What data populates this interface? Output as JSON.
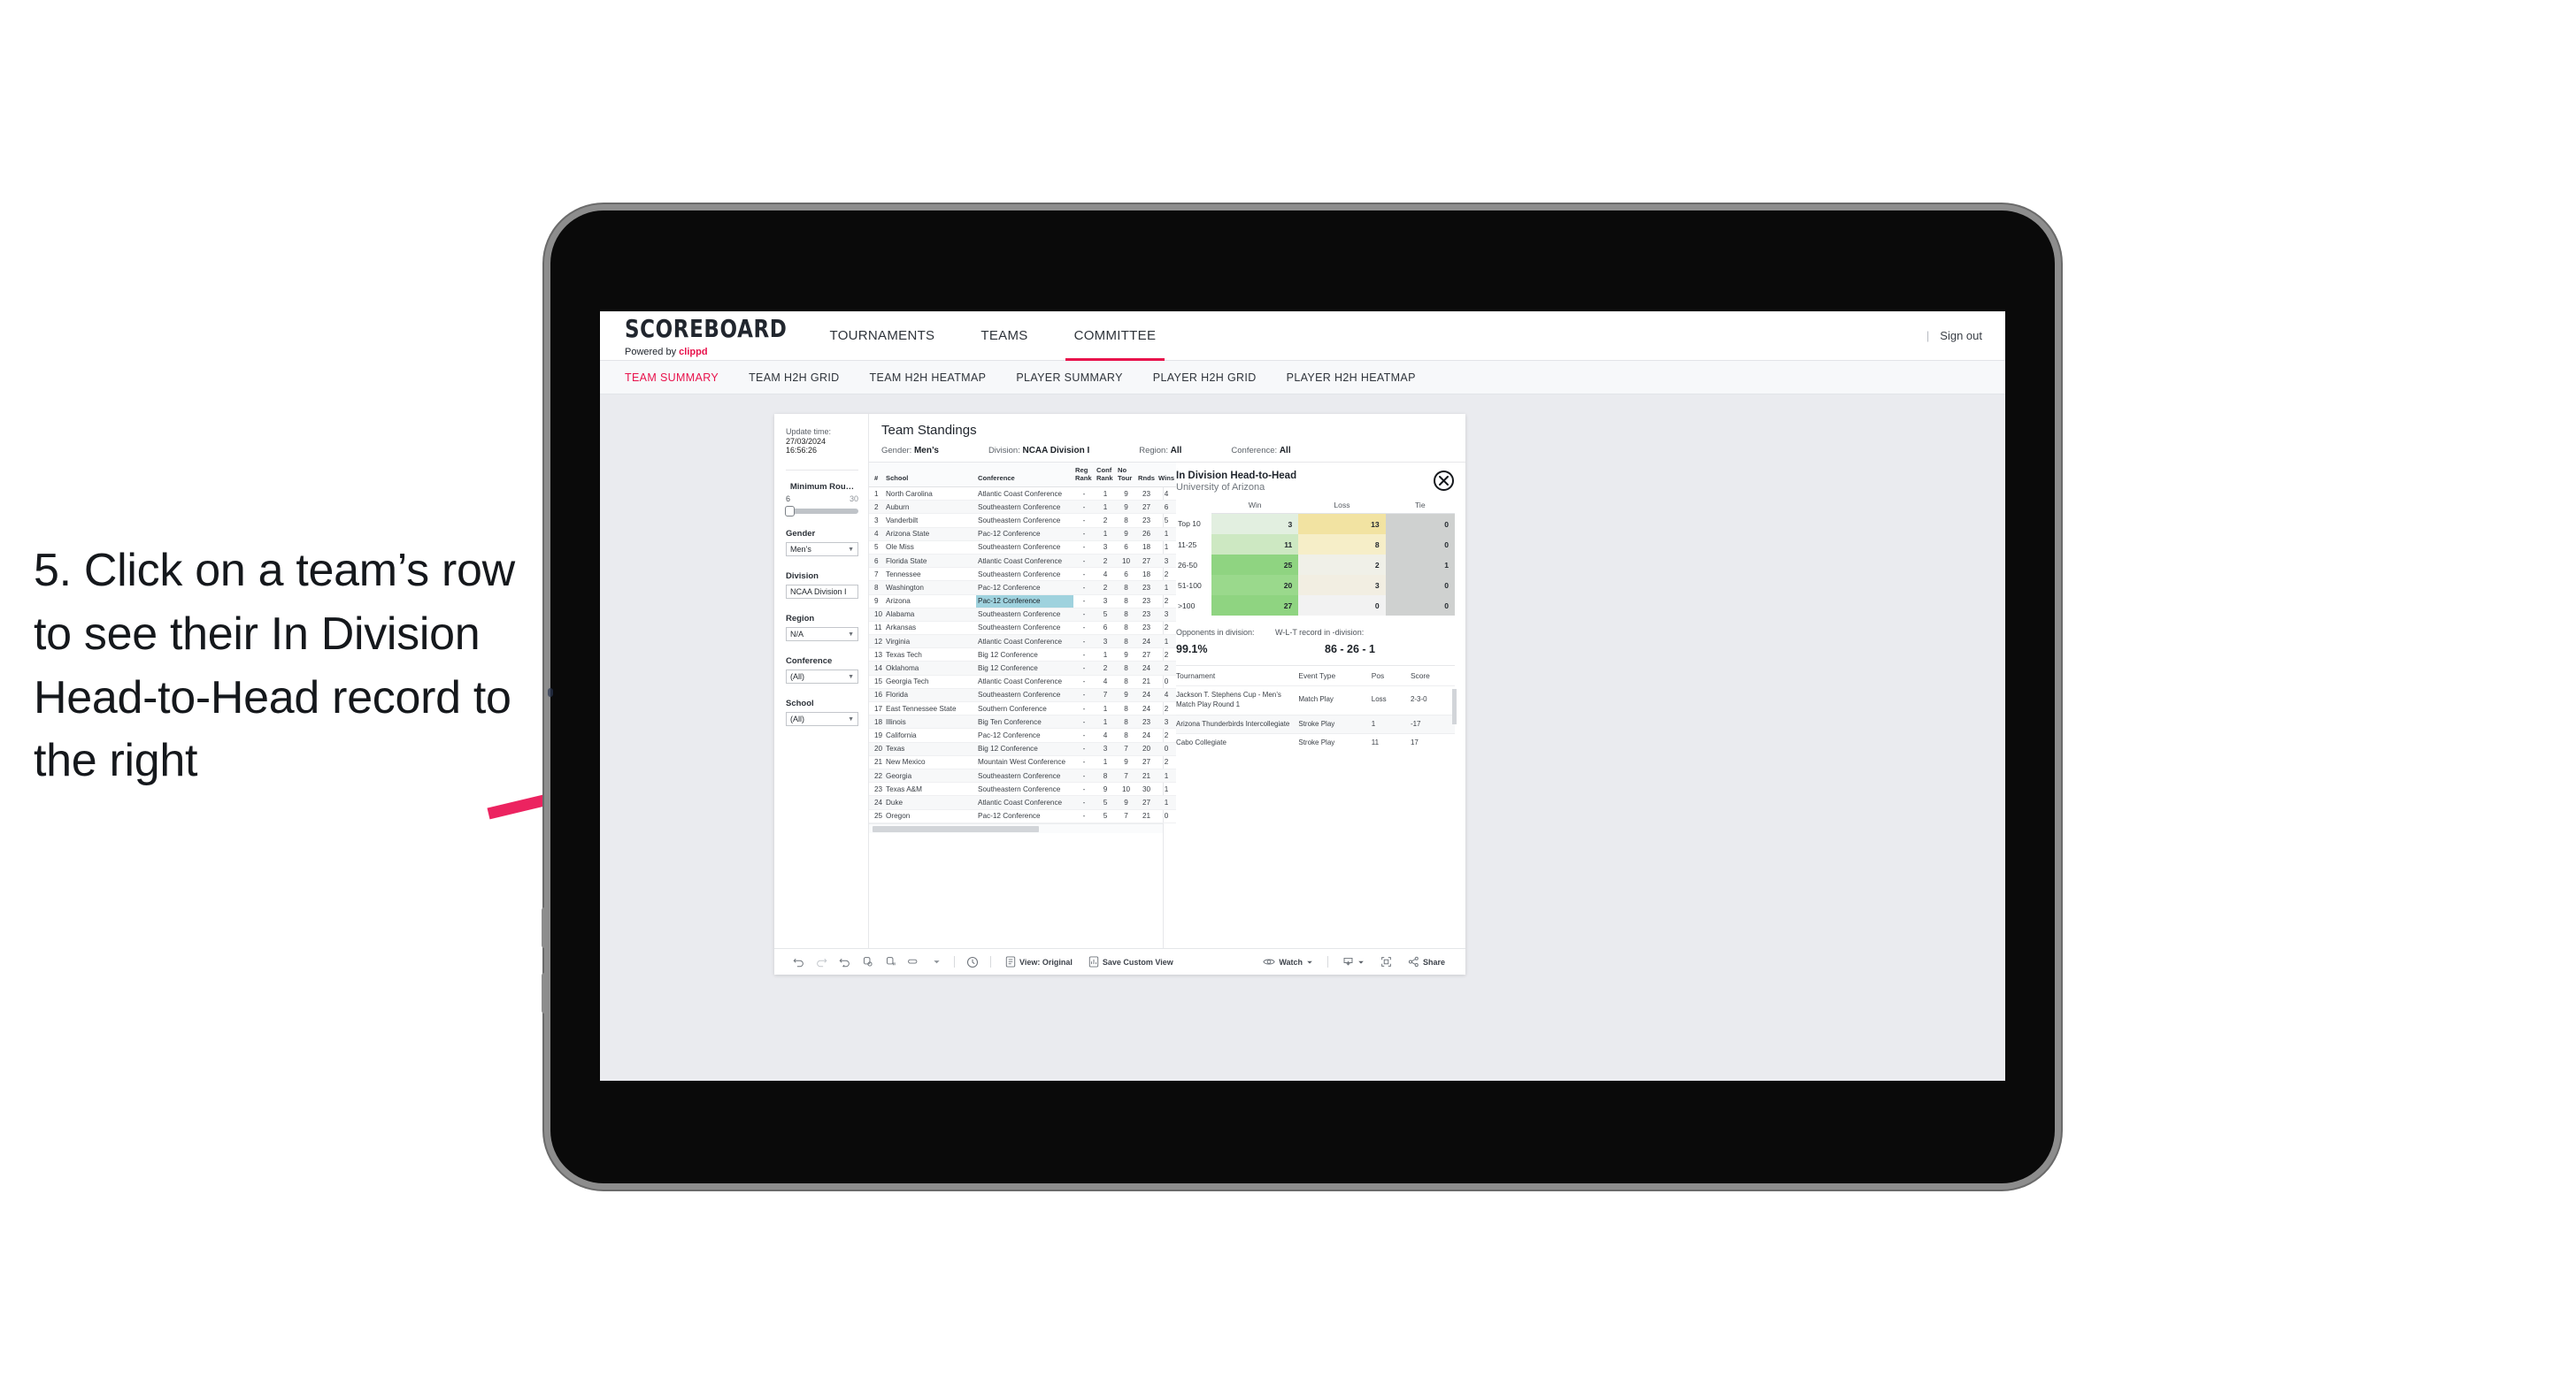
{
  "annotation": {
    "text": "5. Click on a team’s row to see their In Division Head-to-Head record to the right",
    "arrow_color": "#ec2360"
  },
  "app": {
    "logo": {
      "main": "SCOREBOARD",
      "powered_prefix": "Powered by ",
      "brand": "clippd"
    },
    "top_nav": [
      {
        "label": "TOURNAMENTS",
        "active": false
      },
      {
        "label": "TEAMS",
        "active": false
      },
      {
        "label": "COMMITTEE",
        "active": true
      }
    ],
    "sign_out": "Sign out",
    "divider": "|",
    "sub_nav": [
      {
        "label": "TEAM SUMMARY",
        "active": true
      },
      {
        "label": "TEAM H2H GRID",
        "active": false
      },
      {
        "label": "TEAM H2H HEATMAP",
        "active": false
      },
      {
        "label": "PLAYER SUMMARY",
        "active": false
      },
      {
        "label": "PLAYER H2H GRID",
        "active": false
      },
      {
        "label": "PLAYER H2H HEATMAP",
        "active": false
      }
    ],
    "accent": "#e8114b"
  },
  "filters": {
    "update_label": "Update time:",
    "update_time": "27/03/2024 16:56:26",
    "slider": {
      "title": "Minimum Rou…",
      "min": "6",
      "max": "30"
    },
    "groups": [
      {
        "label": "Gender",
        "value": "Men’s",
        "caret": true
      },
      {
        "label": "Division",
        "value": "NCAA Division I",
        "caret": false
      },
      {
        "label": "Region",
        "value": "N/A",
        "caret": true
      },
      {
        "label": "Conference",
        "value": "(All)",
        "caret": true
      },
      {
        "label": "School",
        "value": "(All)",
        "caret": true
      }
    ]
  },
  "standings": {
    "title": "Team Standings",
    "meta": [
      {
        "label": "Gender:",
        "value": "Men’s"
      },
      {
        "label": "Division:",
        "value": "NCAA Division I"
      },
      {
        "label": "Region:",
        "value": "All"
      },
      {
        "label": "Conference:",
        "value": "All"
      }
    ],
    "columns": [
      "#",
      "School",
      "Conference",
      "Reg Rank",
      "Conf Rank",
      "No Tour",
      "Rnds",
      "Wins"
    ],
    "rows": [
      {
        "n": "1",
        "school": "North Carolina",
        "conf": "Atlantic Coast Conference",
        "reg": "-",
        "cr": "1",
        "nt": "9",
        "rnds": "23",
        "wins": "4",
        "selected": false
      },
      {
        "n": "2",
        "school": "Auburn",
        "conf": "Southeastern Conference",
        "reg": "-",
        "cr": "1",
        "nt": "9",
        "rnds": "27",
        "wins": "6",
        "selected": false
      },
      {
        "n": "3",
        "school": "Vanderbilt",
        "conf": "Southeastern Conference",
        "reg": "-",
        "cr": "2",
        "nt": "8",
        "rnds": "23",
        "wins": "5",
        "selected": false
      },
      {
        "n": "4",
        "school": "Arizona State",
        "conf": "Pac-12 Conference",
        "reg": "-",
        "cr": "1",
        "nt": "9",
        "rnds": "26",
        "wins": "1",
        "selected": false
      },
      {
        "n": "5",
        "school": "Ole Miss",
        "conf": "Southeastern Conference",
        "reg": "-",
        "cr": "3",
        "nt": "6",
        "rnds": "18",
        "wins": "1",
        "selected": false
      },
      {
        "n": "6",
        "school": "Florida State",
        "conf": "Atlantic Coast Conference",
        "reg": "-",
        "cr": "2",
        "nt": "10",
        "rnds": "27",
        "wins": "3",
        "selected": false
      },
      {
        "n": "7",
        "school": "Tennessee",
        "conf": "Southeastern Conference",
        "reg": "-",
        "cr": "4",
        "nt": "6",
        "rnds": "18",
        "wins": "2",
        "selected": false
      },
      {
        "n": "8",
        "school": "Washington",
        "conf": "Pac-12 Conference",
        "reg": "-",
        "cr": "2",
        "nt": "8",
        "rnds": "23",
        "wins": "1",
        "selected": false
      },
      {
        "n": "9",
        "school": "Arizona",
        "conf": "Pac-12 Conference",
        "reg": "-",
        "cr": "3",
        "nt": "8",
        "rnds": "23",
        "wins": "2",
        "selected": true
      },
      {
        "n": "10",
        "school": "Alabama",
        "conf": "Southeastern Conference",
        "reg": "-",
        "cr": "5",
        "nt": "8",
        "rnds": "23",
        "wins": "3",
        "selected": false
      },
      {
        "n": "11",
        "school": "Arkansas",
        "conf": "Southeastern Conference",
        "reg": "-",
        "cr": "6",
        "nt": "8",
        "rnds": "23",
        "wins": "2",
        "selected": false
      },
      {
        "n": "12",
        "school": "Virginia",
        "conf": "Atlantic Coast Conference",
        "reg": "-",
        "cr": "3",
        "nt": "8",
        "rnds": "24",
        "wins": "1",
        "selected": false
      },
      {
        "n": "13",
        "school": "Texas Tech",
        "conf": "Big 12 Conference",
        "reg": "-",
        "cr": "1",
        "nt": "9",
        "rnds": "27",
        "wins": "2",
        "selected": false
      },
      {
        "n": "14",
        "school": "Oklahoma",
        "conf": "Big 12 Conference",
        "reg": "-",
        "cr": "2",
        "nt": "8",
        "rnds": "24",
        "wins": "2",
        "selected": false
      },
      {
        "n": "15",
        "school": "Georgia Tech",
        "conf": "Atlantic Coast Conference",
        "reg": "-",
        "cr": "4",
        "nt": "8",
        "rnds": "21",
        "wins": "0",
        "selected": false
      },
      {
        "n": "16",
        "school": "Florida",
        "conf": "Southeastern Conference",
        "reg": "-",
        "cr": "7",
        "nt": "9",
        "rnds": "24",
        "wins": "4",
        "selected": false
      },
      {
        "n": "17",
        "school": "East Tennessee State",
        "conf": "Southern Conference",
        "reg": "-",
        "cr": "1",
        "nt": "8",
        "rnds": "24",
        "wins": "2",
        "selected": false
      },
      {
        "n": "18",
        "school": "Illinois",
        "conf": "Big Ten Conference",
        "reg": "-",
        "cr": "1",
        "nt": "8",
        "rnds": "23",
        "wins": "3",
        "selected": false
      },
      {
        "n": "19",
        "school": "California",
        "conf": "Pac-12 Conference",
        "reg": "-",
        "cr": "4",
        "nt": "8",
        "rnds": "24",
        "wins": "2",
        "selected": false
      },
      {
        "n": "20",
        "school": "Texas",
        "conf": "Big 12 Conference",
        "reg": "-",
        "cr": "3",
        "nt": "7",
        "rnds": "20",
        "wins": "0",
        "selected": false
      },
      {
        "n": "21",
        "school": "New Mexico",
        "conf": "Mountain West Conference",
        "reg": "-",
        "cr": "1",
        "nt": "9",
        "rnds": "27",
        "wins": "2",
        "selected": false
      },
      {
        "n": "22",
        "school": "Georgia",
        "conf": "Southeastern Conference",
        "reg": "-",
        "cr": "8",
        "nt": "7",
        "rnds": "21",
        "wins": "1",
        "selected": false
      },
      {
        "n": "23",
        "school": "Texas A&M",
        "conf": "Southeastern Conference",
        "reg": "-",
        "cr": "9",
        "nt": "10",
        "rnds": "30",
        "wins": "1",
        "selected": false
      },
      {
        "n": "24",
        "school": "Duke",
        "conf": "Atlantic Coast Conference",
        "reg": "-",
        "cr": "5",
        "nt": "9",
        "rnds": "27",
        "wins": "1",
        "selected": false
      },
      {
        "n": "25",
        "school": "Oregon",
        "conf": "Pac-12 Conference",
        "reg": "-",
        "cr": "5",
        "nt": "7",
        "rnds": "21",
        "wins": "0",
        "selected": false
      }
    ]
  },
  "h2h": {
    "title": "In Division Head-to-Head",
    "subtitle": "University of Arizona",
    "close_icon": "close-icon",
    "matrix": {
      "columns": [
        "Win",
        "Loss",
        "Tie"
      ],
      "rows": [
        {
          "label": "Top 10",
          "win": "3",
          "loss": "13",
          "tie": "0",
          "win_color": "#e2efe0",
          "loss_color": "#f2e3a2",
          "tie_color": "#cfd1d0"
        },
        {
          "label": "11-25",
          "win": "11",
          "loss": "8",
          "tie": "0",
          "win_color": "#cde8c2",
          "loss_color": "#f6eec8",
          "tie_color": "#cfd1d0"
        },
        {
          "label": "26-50",
          "win": "25",
          "loss": "2",
          "tie": "1",
          "win_color": "#8fd481",
          "loss_color": "#f0f0e8",
          "tie_color": "#cfd1d0"
        },
        {
          "label": "51-100",
          "win": "20",
          "loss": "3",
          "tie": "0",
          "win_color": "#9ad98c",
          "loss_color": "#f2eee2",
          "tie_color": "#cfd1d0"
        },
        {
          "label": ">100",
          "win": "27",
          "loss": "0",
          "tie": "0",
          "win_color": "#8fd481",
          "loss_color": "#f2f2f2",
          "tie_color": "#cfd1d0"
        }
      ]
    },
    "summary": {
      "opponents_label": "Opponents in division:",
      "opponents_value": "99.1%",
      "record_label": "W-L-T record in -division:",
      "record_value": "86 - 26 - 1"
    },
    "tournaments": {
      "columns": [
        "Tournament",
        "Event Type",
        "Pos",
        "Score"
      ],
      "rows": [
        {
          "name": "Jackson T. Stephens Cup - Men’s Match Play Round 1",
          "type": "Match Play",
          "pos": "Loss",
          "score": "2-3-0"
        },
        {
          "name": "Arizona Thunderbirds Intercollegiate",
          "type": "Stroke Play",
          "pos": "1",
          "score": "-17"
        },
        {
          "name": "Cabo Collegiate",
          "type": "Stroke Play",
          "pos": "11",
          "score": "17"
        }
      ]
    }
  },
  "toolbar": {
    "icons": [
      "undo-icon",
      "redo-icon",
      "revert-icon",
      "refresh-data-icon",
      "pause-refresh-icon",
      "device-layout-icon",
      "chevron-down-icon"
    ],
    "clock_icon": "history-icon",
    "view_label": "View: Original",
    "view_icon": "view-icon",
    "save_label": "Save Custom View",
    "save_icon": "save-view-icon",
    "watch_label": "Watch",
    "watch_icon": "eye-icon",
    "download_icon": "download-icon",
    "fullscreen_icon": "fullscreen-icon",
    "share_label": "Share",
    "share_icon": "share-icon"
  }
}
